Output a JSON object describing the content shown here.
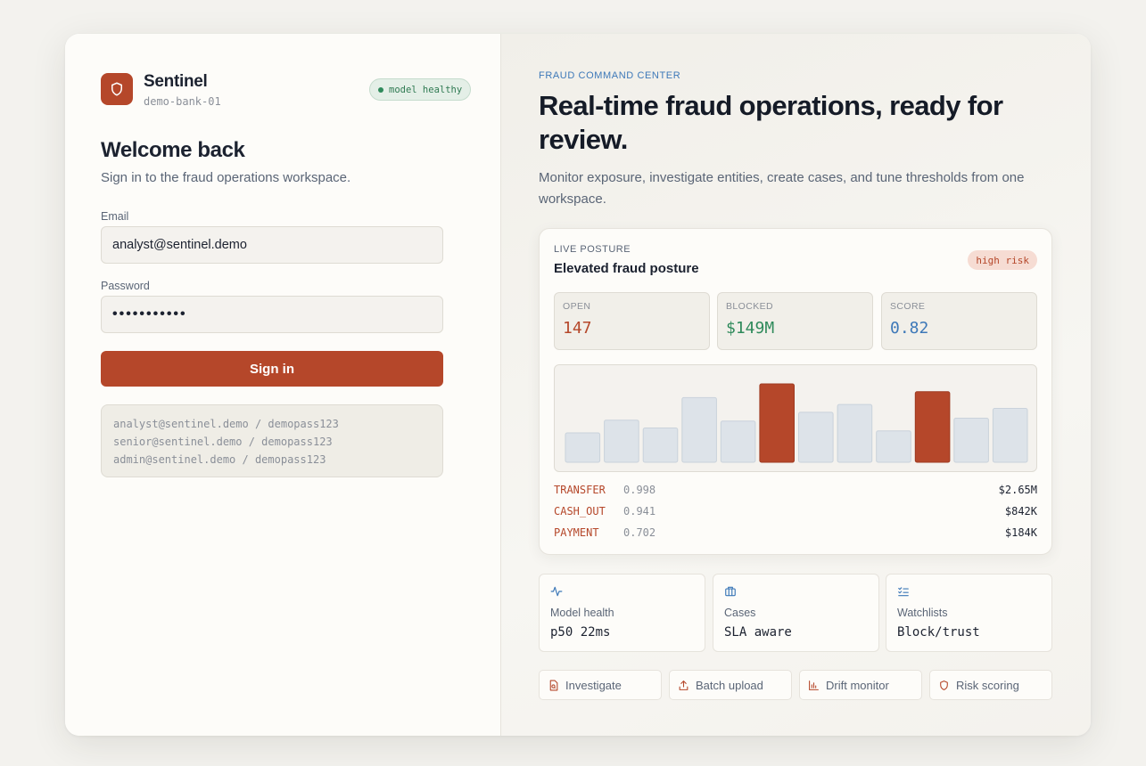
{
  "brand": {
    "name": "Sentinel",
    "tenant": "demo-bank-01",
    "status": "model healthy"
  },
  "login": {
    "title": "Welcome back",
    "subtitle": "Sign in to the fraud operations workspace.",
    "email_label": "Email",
    "email_value": "analyst@sentinel.demo",
    "password_label": "Password",
    "password_value": "•••••••••••",
    "submit_label": "Sign in",
    "demo_accounts": [
      "analyst@sentinel.demo / demopass123",
      "senior@sentinel.demo / demopass123",
      "admin@sentinel.demo / demopass123"
    ]
  },
  "hero": {
    "eyebrow": "FRAUD COMMAND CENTER",
    "headline": "Real-time fraud operations, ready for review.",
    "lede": "Monitor exposure, investigate entities, create cases, and tune thresholds from one workspace."
  },
  "posture": {
    "eyebrow": "LIVE POSTURE",
    "title": "Elevated fraud posture",
    "risk": "high risk",
    "stats": [
      {
        "label": "OPEN",
        "value": "147",
        "color": "#b5472a"
      },
      {
        "label": "BLOCKED",
        "value": "$149M",
        "color": "#2f8a5b"
      },
      {
        "label": "SCORE",
        "value": "0.82",
        "color": "#3d78b8"
      }
    ],
    "segments": [
      {
        "name": "TRANSFER",
        "score": "0.998",
        "amount": "$2.65M"
      },
      {
        "name": "CASH_OUT",
        "score": "0.941",
        "amount": "$842K"
      },
      {
        "name": "PAYMENT",
        "score": "0.702",
        "amount": "$184K"
      }
    ]
  },
  "chart_data": {
    "type": "bar",
    "values": [
      30,
      43,
      35,
      66,
      42,
      80,
      51,
      59,
      32,
      72,
      45,
      55
    ],
    "highlight": [
      5,
      9
    ],
    "ylim": [
      0,
      90
    ],
    "bar_color": "#dde3e9",
    "highlight_color": "#b5472a",
    "grid": false
  },
  "tiles": [
    {
      "icon": "activity-icon",
      "label": "Model health",
      "value": "p50 22ms"
    },
    {
      "icon": "briefcase-icon",
      "label": "Cases",
      "value": "SLA aware"
    },
    {
      "icon": "checklist-icon",
      "label": "Watchlists",
      "value": "Block/trust"
    }
  ],
  "actions": [
    {
      "icon": "file-search-icon",
      "label": "Investigate"
    },
    {
      "icon": "upload-icon",
      "label": "Batch upload"
    },
    {
      "icon": "bar-chart-icon",
      "label": "Drift monitor"
    },
    {
      "icon": "shield-icon",
      "label": "Risk scoring"
    }
  ],
  "colors": {
    "accent": "#b5472a",
    "success": "#2f8a5b",
    "info": "#3d78b8"
  }
}
